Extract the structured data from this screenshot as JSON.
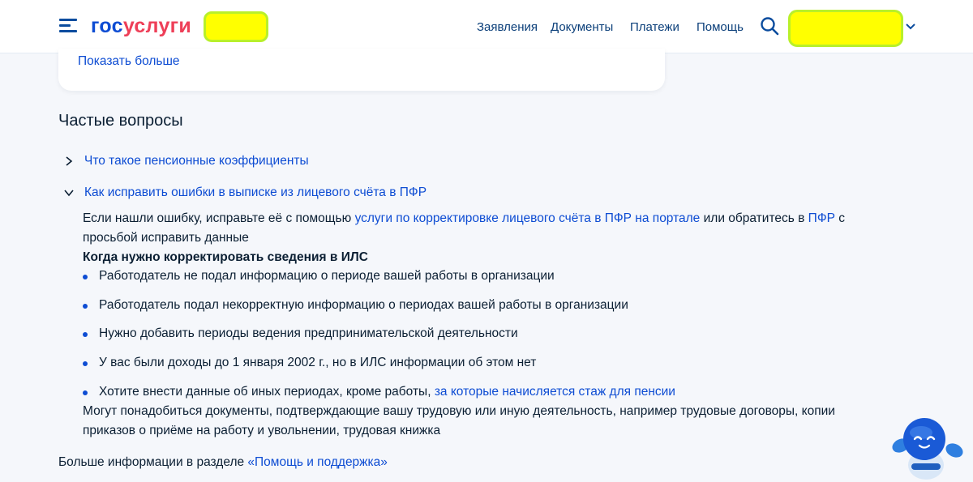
{
  "header": {
    "logo": {
      "part1": "гос",
      "part2": "услуги"
    },
    "nav": [
      {
        "label": "Заявления"
      },
      {
        "label": "Документы"
      },
      {
        "label": "Платежи"
      },
      {
        "label": "Помощь"
      }
    ],
    "icons": {
      "menu": "burger-menu-icon",
      "search": "search-icon",
      "profile_dropdown": "chevron-down-icon"
    }
  },
  "card": {
    "show_more": "Показать больше"
  },
  "faq": {
    "title": "Частые вопросы",
    "questions": [
      {
        "text": "Что такое пенсионные коэффициенты",
        "expanded": false
      },
      {
        "text": "Как исправить ошибки в выписке из лицевого счёта в ПФР",
        "expanded": true
      }
    ],
    "answer": {
      "intro_before_link": "Если нашли ошибку, исправьте её с помощью ",
      "intro_link": "услуги по корректировке лицевого счёта в ПФР на портале",
      "intro_middle": " или обратитесь в ",
      "intro_link2": "ПФР",
      "intro_after": " с просьбой исправить данные",
      "subheading": "Когда нужно корректировать сведения в ИЛС",
      "bullets": [
        {
          "text": "Работодатель не подал информацию о периоде вашей работы в организации"
        },
        {
          "text": "Работодатель подал некорректную информацию о периодах вашей работы в организации"
        },
        {
          "text": "Нужно добавить периоды ведения предпринимательской деятельности"
        },
        {
          "text": "У вас были доходы до 1 января 2002 г., но в ИЛС информации об этом нет"
        },
        {
          "text": "Хотите внести данные об иных периодах, кроме работы, ",
          "link": "за которые начисляется стаж для пенсии"
        }
      ],
      "documents_note": "Могут понадобиться документы, подтверждающие вашу трудовую или иную деятельность, например трудовые договоры, копии приказов о приёме на работу и увольнении, трудовая книжка"
    },
    "more_info": {
      "text": "Больше информации в разделе ",
      "link": "«Помощь и поддержка»"
    }
  },
  "colors": {
    "link": "#0d4cd3",
    "text": "#0b1f33",
    "logo_red": "#ee3f58",
    "highlight": "#ffff00",
    "highlight_border": "#b8f02a",
    "page_bg": "#f5f7fb"
  }
}
